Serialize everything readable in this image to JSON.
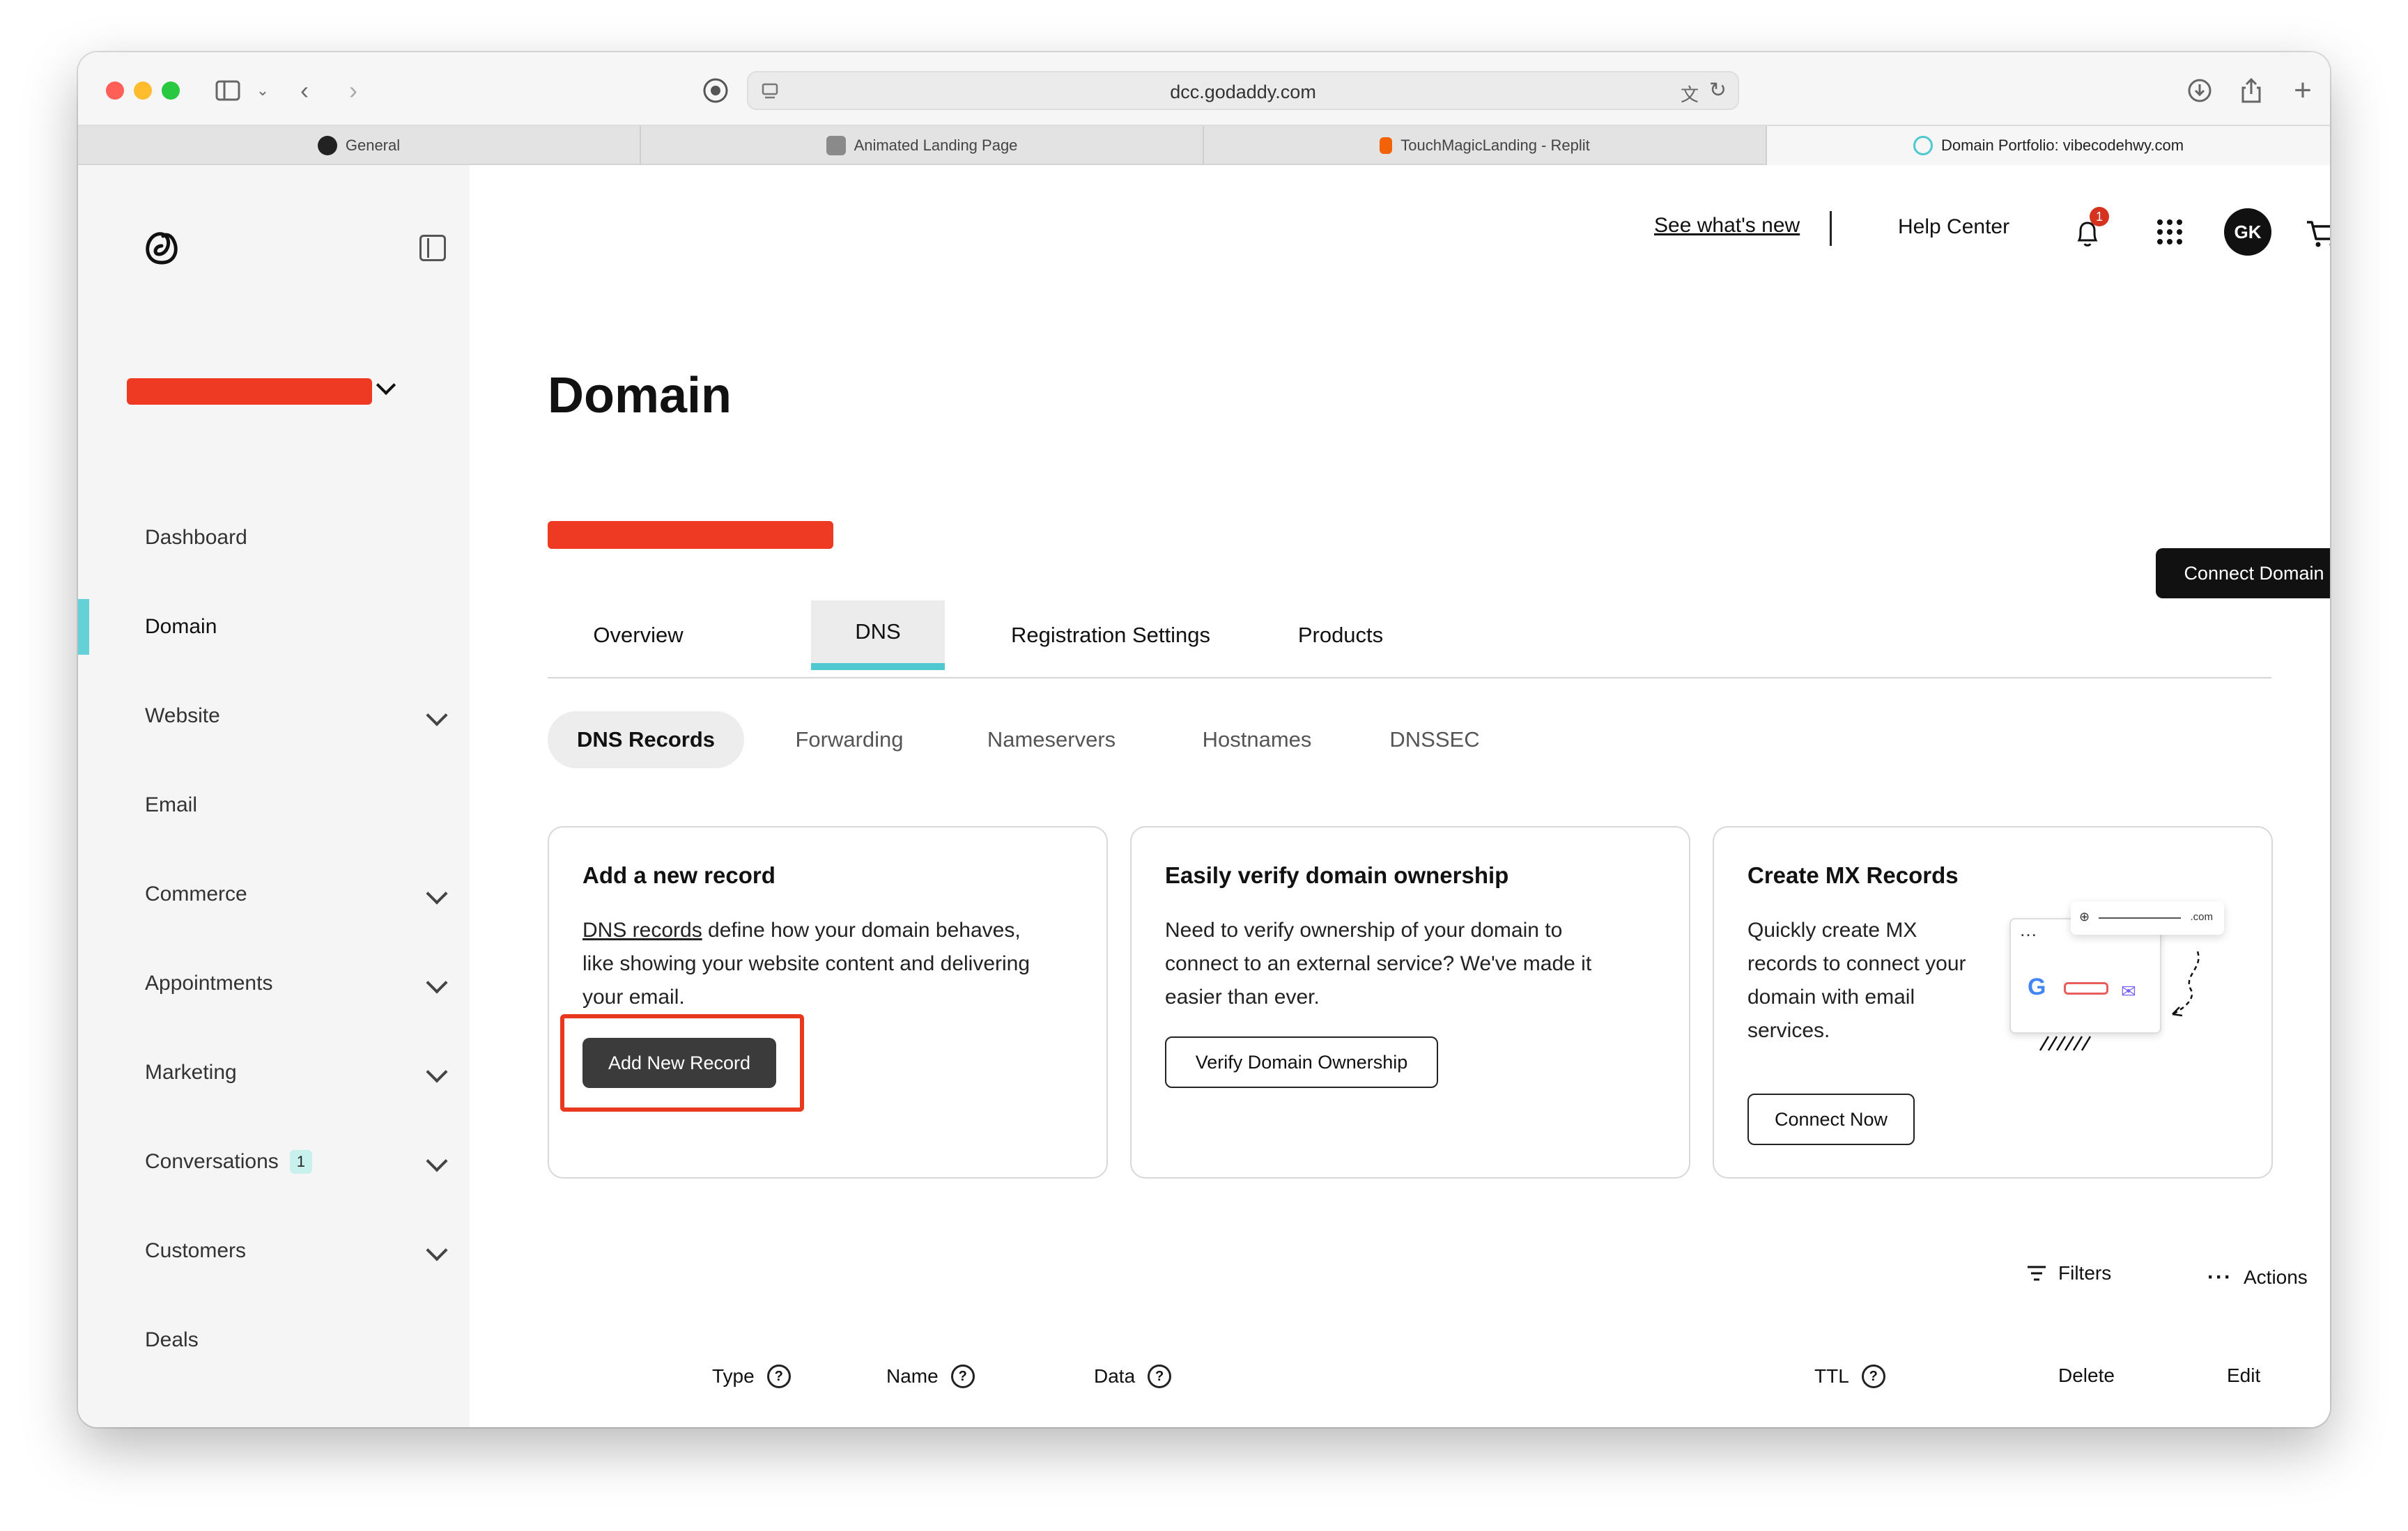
{
  "browser": {
    "url": "dcc.godaddy.com",
    "tabs": [
      {
        "label": "General"
      },
      {
        "label": "Animated Landing Page"
      },
      {
        "label": "TouchMagicLanding - Replit"
      },
      {
        "label": "Domain Portfolio: vibecodehwy.com"
      }
    ]
  },
  "sidebar": {
    "items": [
      {
        "label": "Dashboard"
      },
      {
        "label": "Domain"
      },
      {
        "label": "Website"
      },
      {
        "label": "Email"
      },
      {
        "label": "Commerce"
      },
      {
        "label": "Appointments"
      },
      {
        "label": "Marketing"
      },
      {
        "label": "Conversations",
        "badge": "1"
      },
      {
        "label": "Customers"
      },
      {
        "label": "Deals"
      }
    ]
  },
  "header": {
    "whats_new": "See what's new",
    "help_center": "Help Center",
    "notification_count": "1",
    "avatar_initials": "GK"
  },
  "page": {
    "title": "Domain",
    "connect_domain": "Connect Domain",
    "tabs": [
      "Overview",
      "DNS",
      "Registration Settings",
      "Products"
    ],
    "subtabs": [
      "DNS Records",
      "Forwarding",
      "Nameservers",
      "Hostnames",
      "DNSSEC"
    ]
  },
  "cards": {
    "add_record": {
      "title": "Add a new record",
      "link": "DNS records",
      "body_1": " define how your domain behaves,",
      "body_2": "like showing your website content and delivering",
      "body_3": "your email.",
      "button": "Add New Record"
    },
    "verify": {
      "title": "Easily verify domain ownership",
      "body_1": "Need to verify ownership of your domain to",
      "body_2": "connect to an external service? We've made it",
      "body_3": "easier than ever.",
      "button": "Verify Domain Ownership"
    },
    "mx": {
      "title": "Create MX Records",
      "body_1": "Quickly create MX",
      "body_2": "records to connect your",
      "body_3": "domain with email",
      "body_4": "services.",
      "button": "Connect Now",
      "illustration_tld": ".com"
    }
  },
  "table": {
    "filters": "Filters",
    "actions": "Actions",
    "columns": [
      "Type",
      "Name",
      "Data",
      "TTL",
      "Delete",
      "Edit"
    ]
  },
  "colors": {
    "accent": "#4fc8cf",
    "annotation_red": "#e8391f",
    "primary_button": "#111111"
  }
}
